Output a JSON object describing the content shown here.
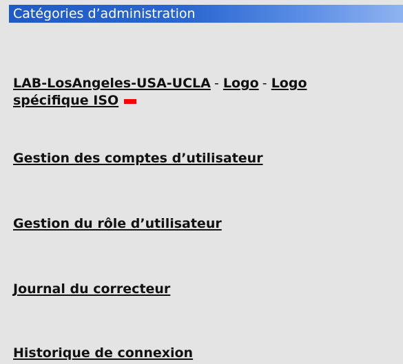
{
  "header": {
    "title": "Catégories d’administration"
  },
  "lab_row": {
    "lab_link": "LAB-LosAngeles-USA-UCLA",
    "separator1": "-",
    "logo_link": "Logo",
    "separator2": "-",
    "logo_iso_link_line1": "Logo",
    "logo_iso_link_line2": "spécifique ISO",
    "status_color": "#ff0000"
  },
  "links": [
    {
      "label": "Gestion des comptes d’utilisateur"
    },
    {
      "label": "Gestion du rôle d’utilisateur"
    },
    {
      "label": "Journal du correcteur"
    },
    {
      "label": "Historique de connexion"
    }
  ],
  "colors": {
    "header_bg": "#2a66cf",
    "panel_bg": "#e4e4e4",
    "link_text": "#111111"
  }
}
